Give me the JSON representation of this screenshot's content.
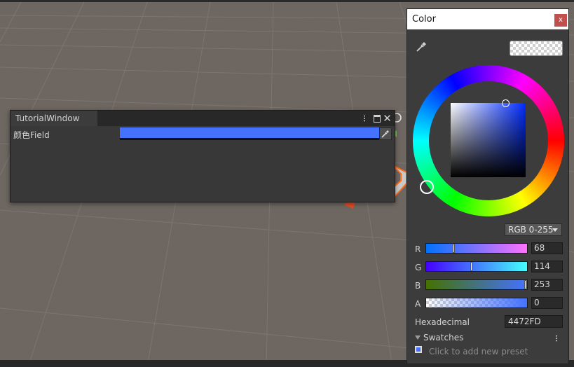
{
  "tutorial_window": {
    "tab_title": "TutorialWindow",
    "field_label": "颜色Field",
    "field_color": "#4472FD"
  },
  "color_picker": {
    "title": "Color",
    "close_label": "x",
    "mode": "RGB 0-255",
    "channels": [
      {
        "label": "R",
        "value": "68"
      },
      {
        "label": "G",
        "value": "114"
      },
      {
        "label": "B",
        "value": "253"
      },
      {
        "label": "A",
        "value": "0"
      }
    ],
    "hex_label": "Hexadecimal",
    "hex_value": "4472FD",
    "swatches_label": "Swatches",
    "preset_hint": "Click to add new preset"
  }
}
